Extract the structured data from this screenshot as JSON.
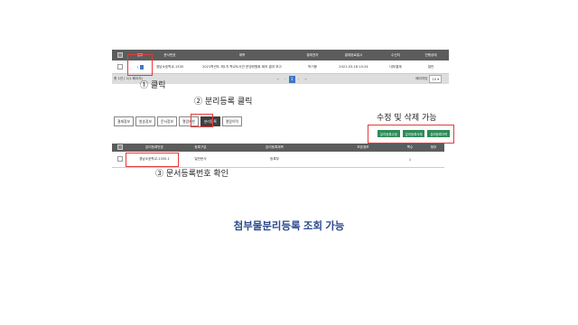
{
  "top_table": {
    "headers": [
      "",
      "첨부",
      "문서번호",
      "제목",
      "결재권자",
      "결재완료일시",
      "수신처",
      "진행상태"
    ],
    "row": {
      "attach_count": "1",
      "doc_number": "경남소호학교-1335",
      "title": "2021학년도 제1차 학교도서관 운영위원회 회의 결과 보고",
      "approver": "박기봉",
      "date": "2021-03-18 15:24",
      "recipient": "내부결재",
      "status": "일반"
    },
    "pager": {
      "total_text": "총 1건 ( 1/1 페이지)",
      "current_page": "1",
      "per_page_label": "페이지당",
      "per_page_value": "10"
    }
  },
  "annotations": {
    "step1": "① 클릭",
    "step2": "② 분리등록 클릭",
    "edit_delete": "수정 및 삭제 가능",
    "step3": "③ 문서등록번호 확인"
  },
  "tabs": [
    "결재정보",
    "발송정보",
    "문서정보",
    "열람제한",
    "분리등록",
    "열람이력"
  ],
  "action_buttons": [
    "분리등록수정",
    "분리등록삭제",
    "분리등록이력"
  ],
  "bottom_table": {
    "headers": [
      "",
      "분리등록번호",
      "등록구분",
      "분리등록제목",
      "보존정보",
      "쪽수",
      "첨부"
    ],
    "row": {
      "reg_number": "경남소호학교-1335-1",
      "reg_type": "일반문서",
      "title": "등록부",
      "retention": "",
      "pages": "1",
      "attach": ""
    }
  },
  "caption": "첨부물분리등록 조회 가능"
}
